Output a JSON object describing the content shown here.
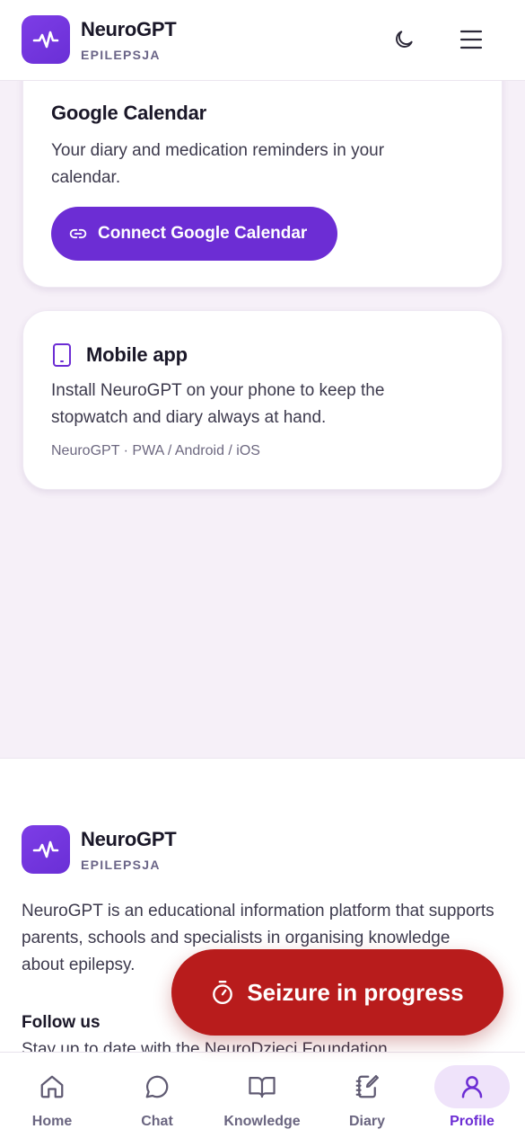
{
  "brand": {
    "name": "NeuroGPT",
    "subtitle": "EPILEPSJA"
  },
  "header": {
    "theme_icon": "moon-icon",
    "menu_icon": "hamburger-menu-icon"
  },
  "google_calendar_card": {
    "title": "Google Calendar",
    "description": "Your diary and medication reminders in your calendar.",
    "button_label": "Connect Google Calendar",
    "button_icon": "link-icon"
  },
  "mobile_app_card": {
    "icon": "phone-icon",
    "title": "Mobile app",
    "description": "Install NeuroGPT on your phone to keep the stopwatch and diary always at hand.",
    "meta": "NeuroGPT · PWA / Android / iOS"
  },
  "footer": {
    "brand_name": "NeuroGPT",
    "brand_subtitle": "EPILEPSJA",
    "description": "NeuroGPT is an educational information platform that supports parents, schools and specialists in organising knowledge about epilepsy.",
    "follow_title": "Follow us",
    "follow_text": "Stay up to date with the NeuroDzieci Foundation"
  },
  "seizure_button": {
    "label": "Seizure in progress",
    "icon": "stopwatch-icon",
    "color": "#b81c1c"
  },
  "bottom_nav": {
    "items": [
      {
        "label": "Home",
        "icon": "home-icon"
      },
      {
        "label": "Chat",
        "icon": "chat-bubble-icon"
      },
      {
        "label": "Knowledge",
        "icon": "book-icon"
      },
      {
        "label": "Diary",
        "icon": "notebook-icon"
      },
      {
        "label": "Profile",
        "icon": "user-icon",
        "active": true
      }
    ]
  },
  "colors": {
    "accent": "#6c2dd4",
    "background": "#f6f0f8",
    "danger": "#b81c1c"
  }
}
